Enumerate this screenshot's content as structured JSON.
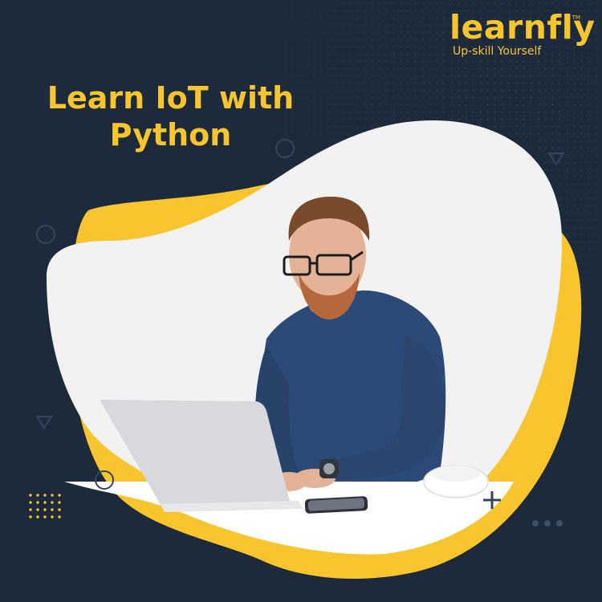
{
  "brand": {
    "name": "learnfly",
    "tagline": "Up-skill Yourself",
    "trademark": "TM"
  },
  "headline": {
    "line1": "Learn IoT with",
    "line2": "Python"
  },
  "colors": {
    "background": "#1d2a3c",
    "accent": "#f8c52f",
    "blob": "#f2f2f2"
  },
  "icons": [
    "circle-outline-icon",
    "triangle-outline-icon",
    "plus-icon",
    "dot-grid-icon",
    "three-dots-icon"
  ]
}
